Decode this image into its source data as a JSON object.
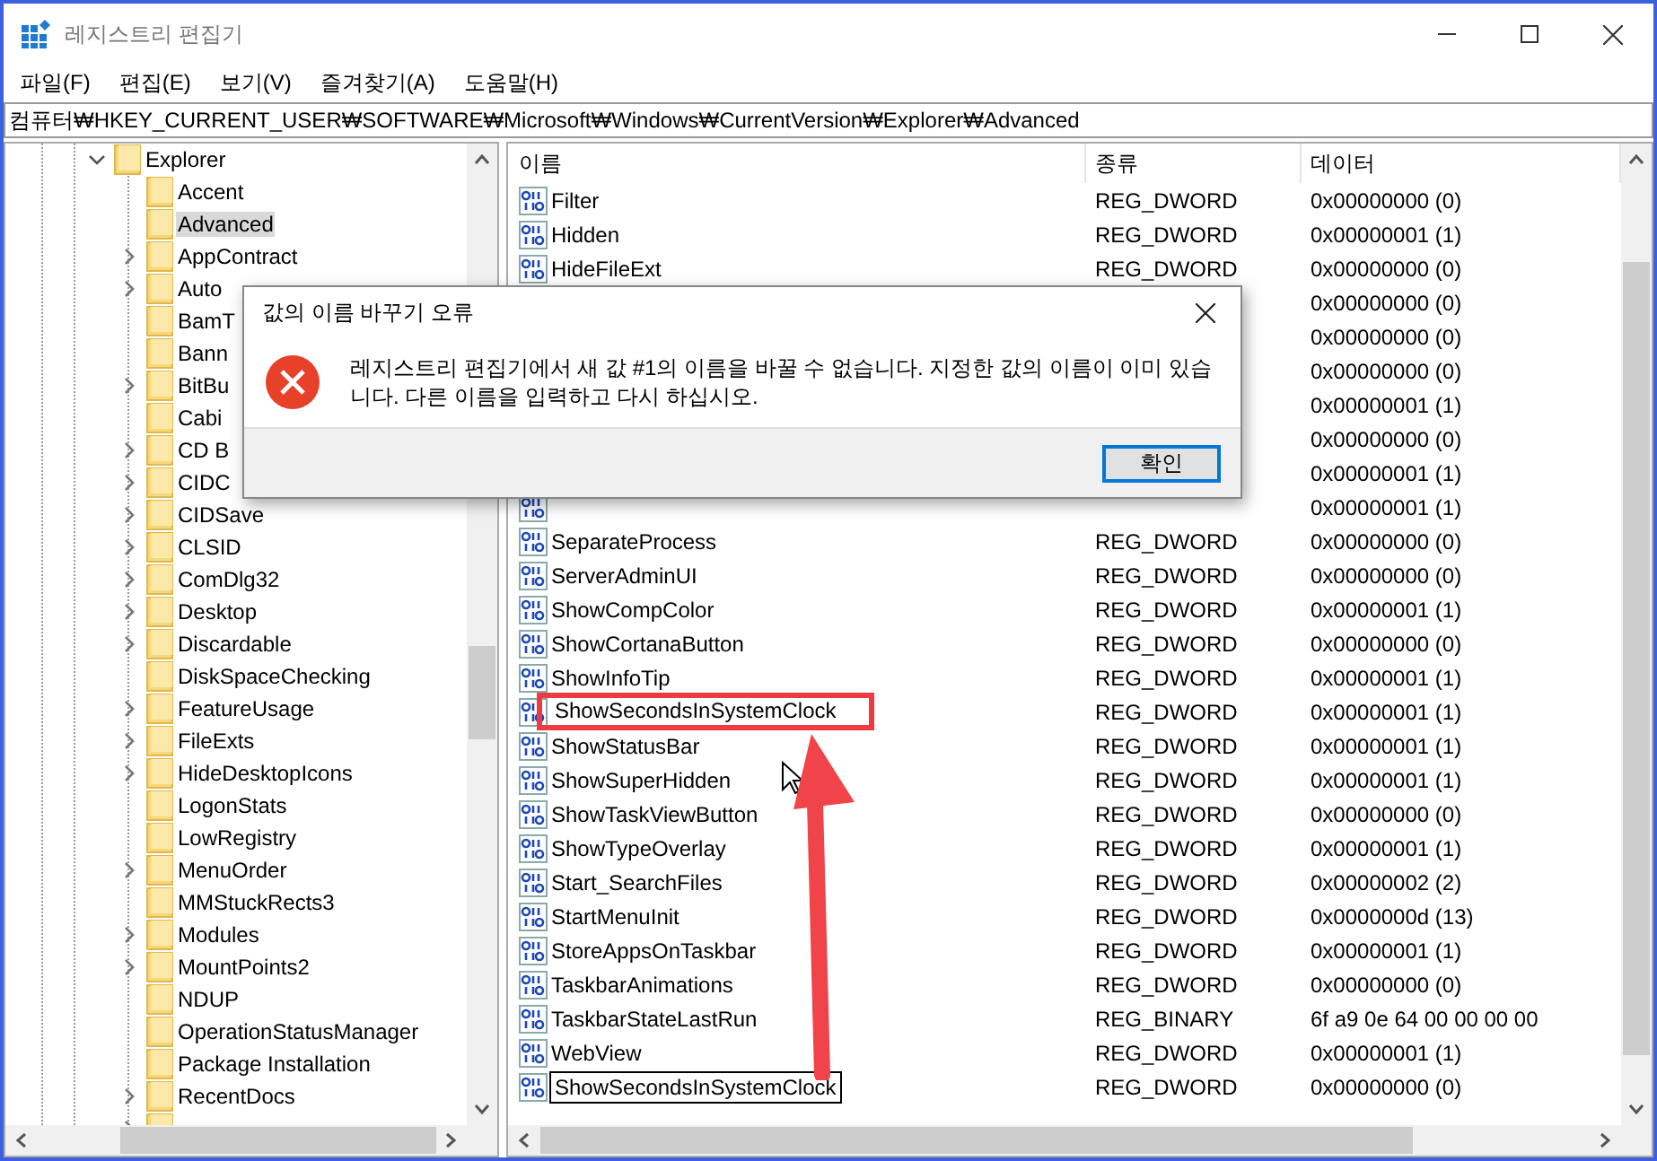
{
  "window": {
    "title": "레지스트리 편집기"
  },
  "menu": [
    "파일(F)",
    "편집(E)",
    "보기(V)",
    "즐겨찾기(A)",
    "도움말(H)"
  ],
  "address": "컴퓨터₩HKEY_CURRENT_USER₩SOFTWARE₩Microsoft₩Windows₩CurrentVersion₩Explorer₩Advanced",
  "tree": [
    {
      "label": "Explorer",
      "has_children": true,
      "expanded": true,
      "selected": false,
      "children": [
        {
          "label": "Accent",
          "has_children": false,
          "selected": false
        },
        {
          "label": "Advanced",
          "has_children": false,
          "selected": true
        },
        {
          "label": "AppContract",
          "has_children": true,
          "selected": false
        },
        {
          "label": "Auto",
          "has_children": true,
          "selected": false
        },
        {
          "label": "BamT",
          "has_children": false,
          "selected": false
        },
        {
          "label": "Bann",
          "has_children": false,
          "selected": false
        },
        {
          "label": "BitBu",
          "has_children": true,
          "selected": false
        },
        {
          "label": "Cabi",
          "has_children": false,
          "selected": false
        },
        {
          "label": "CD B",
          "has_children": true,
          "selected": false
        },
        {
          "label": "CIDC",
          "has_children": true,
          "selected": false
        },
        {
          "label": "CIDSave",
          "has_children": true,
          "selected": false
        },
        {
          "label": "CLSID",
          "has_children": true,
          "selected": false
        },
        {
          "label": "ComDlg32",
          "has_children": true,
          "selected": false
        },
        {
          "label": "Desktop",
          "has_children": true,
          "selected": false
        },
        {
          "label": "Discardable",
          "has_children": true,
          "selected": false
        },
        {
          "label": "DiskSpaceChecking",
          "has_children": false,
          "selected": false
        },
        {
          "label": "FeatureUsage",
          "has_children": true,
          "selected": false
        },
        {
          "label": "FileExts",
          "has_children": true,
          "selected": false
        },
        {
          "label": "HideDesktopIcons",
          "has_children": true,
          "selected": false
        },
        {
          "label": "LogonStats",
          "has_children": false,
          "selected": false
        },
        {
          "label": "LowRegistry",
          "has_children": false,
          "selected": false
        },
        {
          "label": "MenuOrder",
          "has_children": true,
          "selected": false
        },
        {
          "label": "MMStuckRects3",
          "has_children": false,
          "selected": false
        },
        {
          "label": "Modules",
          "has_children": true,
          "selected": false
        },
        {
          "label": "MountPoints2",
          "has_children": true,
          "selected": false
        },
        {
          "label": "NDUP",
          "has_children": false,
          "selected": false
        },
        {
          "label": "OperationStatusManager",
          "has_children": false,
          "selected": false
        },
        {
          "label": "Package Installation",
          "has_children": false,
          "selected": false
        },
        {
          "label": "RecentDocs",
          "has_children": true,
          "selected": false
        },
        {
          "has_children": true
        }
      ]
    }
  ],
  "table": {
    "columns": [
      "이름",
      "종류",
      "데이터"
    ],
    "rows": [
      {
        "name": "Filter",
        "type": "REG_DWORD",
        "data": "0x00000000 (0)",
        "highlighted": false,
        "editing": false
      },
      {
        "name": "Hidden",
        "type": "REG_DWORD",
        "data": "0x00000001 (1)",
        "highlighted": false,
        "editing": false
      },
      {
        "name": "HideFileExt",
        "type": "REG_DWORD",
        "data": "0x00000000 (0)",
        "highlighted": false,
        "editing": false
      },
      {
        "data": "0x00000000 (0)",
        "highlighted": false,
        "editing": false
      },
      {
        "data": "0x00000000 (0)",
        "highlighted": false,
        "editing": false
      },
      {
        "data": "0x00000000 (0)",
        "highlighted": false,
        "editing": false
      },
      {
        "data": "0x00000001 (1)",
        "highlighted": false,
        "editing": false
      },
      {
        "data": "0x00000000 (0)",
        "highlighted": false,
        "editing": false
      },
      {
        "data": "0x00000001 (1)",
        "highlighted": false,
        "editing": false
      },
      {
        "data": "0x00000001 (1)",
        "icon_visible": true,
        "highlighted": false,
        "editing": false
      },
      {
        "name": "SeparateProcess",
        "type": "REG_DWORD",
        "data": "0x00000000 (0)",
        "highlighted": false,
        "editing": false
      },
      {
        "name": "ServerAdminUI",
        "type": "REG_DWORD",
        "data": "0x00000000 (0)",
        "highlighted": false,
        "editing": false
      },
      {
        "name": "ShowCompColor",
        "type": "REG_DWORD",
        "data": "0x00000001 (1)",
        "highlighted": false,
        "editing": false
      },
      {
        "name": "ShowCortanaButton",
        "type": "REG_DWORD",
        "data": "0x00000000 (0)",
        "highlighted": false,
        "editing": false
      },
      {
        "name": "ShowInfoTip",
        "type": "REG_DWORD",
        "data": "0x00000001 (1)",
        "highlighted": false,
        "editing": false
      },
      {
        "name": "ShowSecondsInSystemClock",
        "type": "REG_DWORD",
        "data": "0x00000001 (1)",
        "highlighted": true,
        "editing": false
      },
      {
        "name": "ShowStatusBar",
        "type": "REG_DWORD",
        "data": "0x00000001 (1)",
        "highlighted": false,
        "editing": false
      },
      {
        "name": "ShowSuperHidden",
        "type": "REG_DWORD",
        "data": "0x00000001 (1)",
        "highlighted": false,
        "editing": false
      },
      {
        "name": "ShowTaskViewButton",
        "type": "REG_DWORD",
        "data": "0x00000000 (0)",
        "highlighted": false,
        "editing": false
      },
      {
        "name": "ShowTypeOverlay",
        "type": "REG_DWORD",
        "data": "0x00000001 (1)",
        "highlighted": false,
        "editing": false
      },
      {
        "name": "Start_SearchFiles",
        "type": "REG_DWORD",
        "data": "0x00000002 (2)",
        "highlighted": false,
        "editing": false
      },
      {
        "name": "StartMenuInit",
        "type": "REG_DWORD",
        "data": "0x0000000d (13)",
        "highlighted": false,
        "editing": false
      },
      {
        "name": "StoreAppsOnTaskbar",
        "type": "REG_DWORD",
        "data": "0x00000001 (1)",
        "highlighted": false,
        "editing": false
      },
      {
        "name": "TaskbarAnimations",
        "type": "REG_DWORD",
        "data": "0x00000000 (0)",
        "highlighted": false,
        "editing": false
      },
      {
        "name": "TaskbarStateLastRun",
        "type": "REG_BINARY",
        "data": "6f a9 0e 64 00 00 00 00",
        "highlighted": false,
        "editing": false
      },
      {
        "name": "WebView",
        "type": "REG_DWORD",
        "data": "0x00000001 (1)",
        "highlighted": false,
        "editing": false
      },
      {
        "name": "ShowSecondsInSystemClock",
        "type": "REG_DWORD",
        "data": "0x00000000 (0)",
        "highlighted": false,
        "editing": true
      }
    ]
  },
  "dialog": {
    "title": "값의 이름 바꾸기 오류",
    "message": "레지스트리 편집기에서 새 값 #1의 이름을 바꿀 수 없습니다. 지정한 값의 이름이 이미 있습니다. 다른 이름을 입력하고 다시 하십시오.",
    "button": "확인"
  }
}
